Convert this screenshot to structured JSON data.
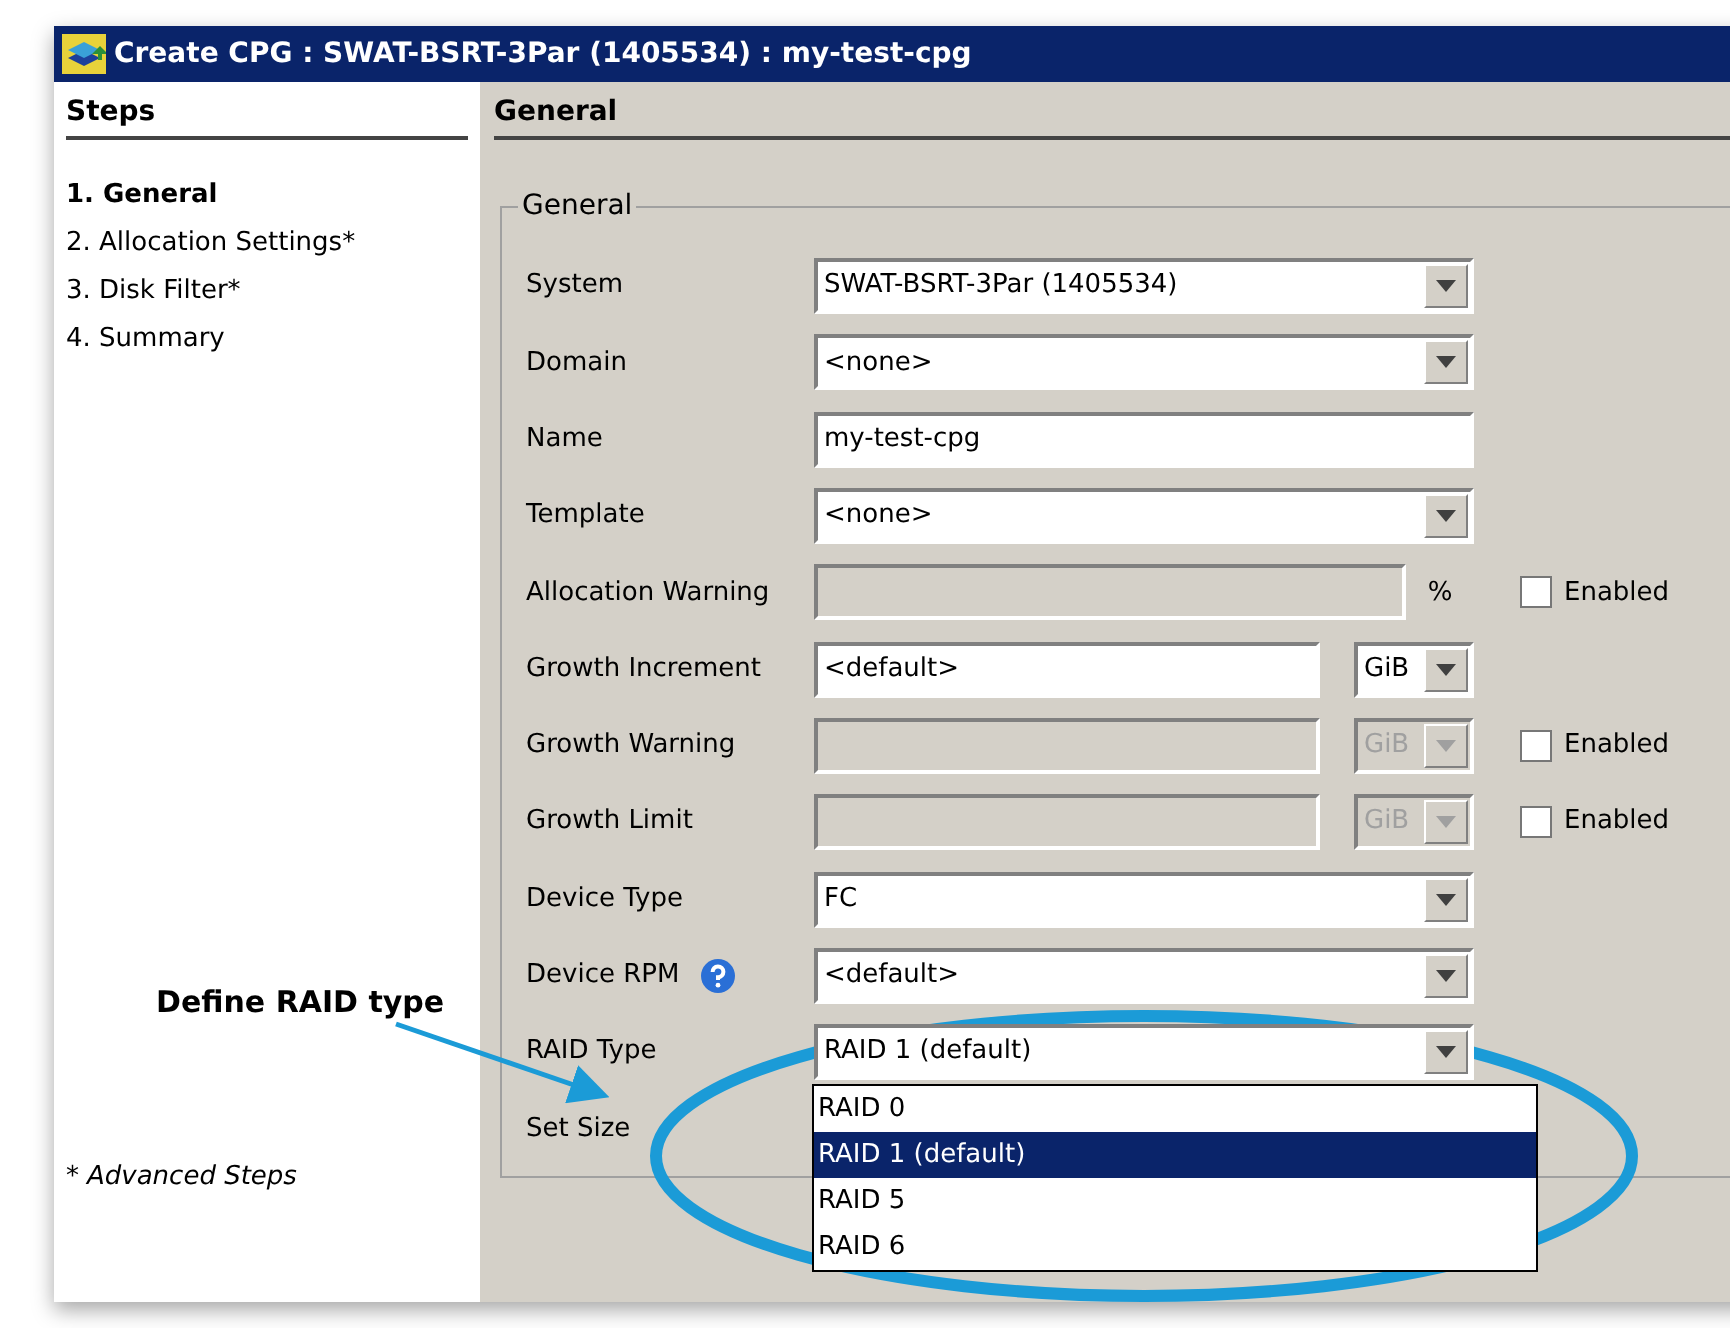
{
  "window": {
    "title": "Create CPG : SWAT-BSRT-3Par (1405534) : my-test-cpg"
  },
  "steps": {
    "heading": "Steps",
    "items": [
      {
        "label": "1. General",
        "selected": true
      },
      {
        "label": "2. Allocation Settings*",
        "selected": false
      },
      {
        "label": "3. Disk Filter*",
        "selected": false
      },
      {
        "label": "4. Summary",
        "selected": false
      }
    ],
    "footnote": {
      "mark": "*",
      "text": "Advanced Steps"
    }
  },
  "panel": {
    "heading": "General",
    "group": {
      "legend": "General",
      "fields": [
        {
          "label": "System",
          "kind": "combo",
          "value": "SWAT-BSRT-3Par (1405534)",
          "disabled": false
        },
        {
          "label": "Domain",
          "kind": "combo",
          "value": "<none>",
          "disabled": false
        },
        {
          "label": "Name",
          "kind": "text",
          "value": "my-test-cpg",
          "disabled": false
        },
        {
          "label": "Template",
          "kind": "combo",
          "value": "<none>",
          "disabled": false
        },
        {
          "label": "Allocation Warning",
          "kind": "text",
          "disabled": true,
          "suffix": "%",
          "option": {
            "label": "Enabled",
            "checked": false
          }
        },
        {
          "label": "Growth Increment",
          "kind": "text",
          "value": "<default>",
          "disabled": false,
          "unit": {
            "value": "GiB",
            "disabled": false
          }
        },
        {
          "label": "Growth Warning",
          "kind": "text",
          "disabled": true,
          "unit": {
            "value": "GiB",
            "disabled": true
          },
          "option": {
            "label": "Enabled",
            "checked": false
          }
        },
        {
          "label": "Growth Limit",
          "kind": "text",
          "disabled": true,
          "unit": {
            "value": "GiB",
            "disabled": true
          },
          "option": {
            "label": "Enabled",
            "checked": false
          }
        },
        {
          "label": "Device Type",
          "kind": "combo",
          "value": "FC",
          "disabled": false
        },
        {
          "label": "Device RPM",
          "kind": "combo",
          "value": "<default>",
          "disabled": false,
          "help": true
        },
        {
          "label": "RAID Type",
          "kind": "combo",
          "value": "RAID 1 (default)",
          "disabled": false,
          "options": [
            {
              "label": "RAID 0",
              "selected": false
            },
            {
              "label": "RAID 1 (default)",
              "selected": true
            },
            {
              "label": "RAID 5",
              "selected": false
            },
            {
              "label": "RAID 6",
              "selected": false
            }
          ]
        },
        {
          "label": "Set Size",
          "kind": "label"
        }
      ]
    }
  },
  "annotation": {
    "text": "Define RAID type"
  }
}
